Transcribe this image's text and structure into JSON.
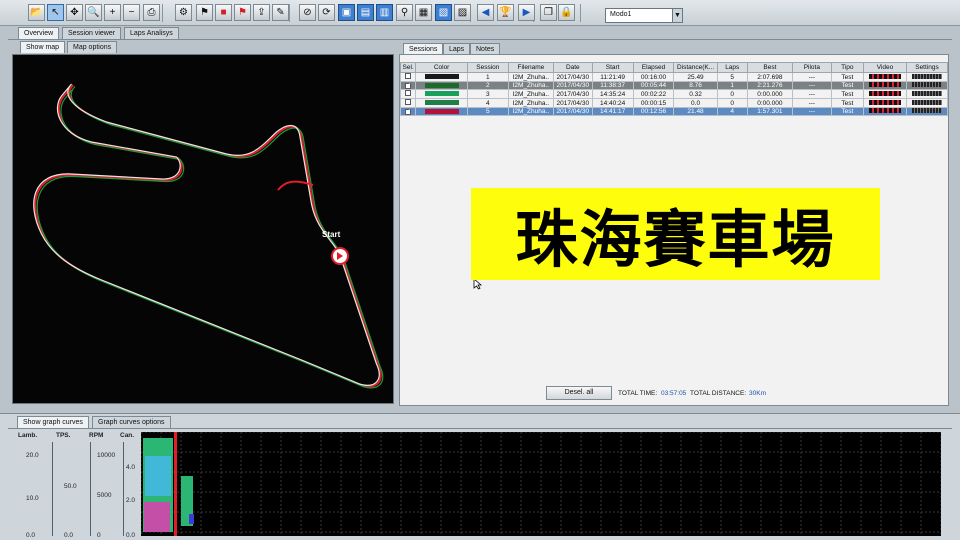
{
  "toolbar": {
    "mode_value": "Modo1",
    "buttons": [
      "open-icon",
      "select-icon",
      "move-icon",
      "zoom-icon",
      "zoom-in-icon",
      "zoom-out-icon",
      "print-icon",
      "gear-icon",
      "flag-icon",
      "red-square-icon",
      "red-flag-icon",
      "export-icon",
      "chat-icon",
      "no-icon",
      "sync-icon",
      "grid1-icon",
      "grid2-icon",
      "grid3-icon",
      "graph-icon",
      "qr-icon",
      "image-icon",
      "film-icon",
      "prev-icon",
      "trophy-icon",
      "next-icon",
      "copy-icon",
      "lock-icon"
    ]
  },
  "main_tabs": [
    "Overview",
    "Session viewer",
    "Laps Analisys"
  ],
  "map_tabs": [
    "Show map",
    "Map options"
  ],
  "map": {
    "start_label": "Start",
    "track_colors": [
      "#e11d2a",
      "#1e9a3a",
      "#e8e8e8"
    ]
  },
  "right_tabs": [
    "Sessions",
    "Laps",
    "Notes"
  ],
  "table": {
    "headers": [
      "Sel.",
      "Color",
      "Session",
      "Filename",
      "Date",
      "Start",
      "Elapsed",
      "Distance(K...",
      "Laps",
      "Best",
      "Pilota",
      "Tipo",
      "Video",
      "Settings"
    ],
    "rows": [
      {
        "checked": false,
        "color": "#1a1a1a",
        "session": "1",
        "filename": "I2M_Zhuha..",
        "date": "2017/04/30",
        "start": "11:21:49",
        "elapsed": "00:16:00",
        "distance": "25.49",
        "laps": "5",
        "best": "2:07.698",
        "pilota": "---",
        "tipo": "Test",
        "style": ""
      },
      {
        "checked": true,
        "color": "#1c6b2c",
        "session": "2",
        "filename": "I2M_Zhuha..",
        "date": "2017/04/30",
        "start": "11:38:37",
        "elapsed": "00:05:44",
        "distance": "8.76",
        "laps": "1",
        "best": "2:21.276",
        "pilota": "---",
        "tipo": "Test",
        "style": "hl2"
      },
      {
        "checked": false,
        "color": "#19a05a",
        "session": "3",
        "filename": "I2M_Zhuha..",
        "date": "2017/04/30",
        "start": "14:35:24",
        "elapsed": "00:02:22",
        "distance": "0.32",
        "laps": "0",
        "best": "0:00.000",
        "pilota": "---",
        "tipo": "Test",
        "style": ""
      },
      {
        "checked": false,
        "color": "#1f7d4a",
        "session": "4",
        "filename": "I2M_Zhuha..",
        "date": "2017/04/30",
        "start": "14:40:24",
        "elapsed": "00:00:15",
        "distance": "0.0",
        "laps": "0",
        "best": "0:00.000",
        "pilota": "---",
        "tipo": "Test",
        "style": ""
      },
      {
        "checked": true,
        "color": "#b3123a",
        "session": "5",
        "filename": "I2M_Zhuha..",
        "date": "2017/04/30",
        "start": "14:41:17",
        "elapsed": "00:12:56",
        "distance": "21.48",
        "laps": "4",
        "best": "1:57.301",
        "pilota": "---",
        "tipo": "Test",
        "style": "hl"
      }
    ]
  },
  "footer": {
    "deselect_label": "Desel. all",
    "total_time_label": "TOTAL TIME:",
    "total_time_value": "03:57:05",
    "total_distance_label": "TOTAL DISTANCE:",
    "total_distance_value": "30Km"
  },
  "overlay_text": "珠海賽車場",
  "graph_tabs": [
    "Show graph curves",
    "Graph curves options"
  ],
  "graph": {
    "channels": [
      {
        "name": "Lamb.",
        "ticks": [
          "20.0",
          "10.0",
          "0.0"
        ]
      },
      {
        "name": "TPS.",
        "ticks": [
          "50.0",
          "0.0"
        ]
      },
      {
        "name": "RPM",
        "ticks": [
          "10000",
          "5000",
          "0"
        ]
      },
      {
        "name": "Can.",
        "ticks": [
          "4.0",
          "2.0",
          "0.0"
        ]
      }
    ]
  }
}
